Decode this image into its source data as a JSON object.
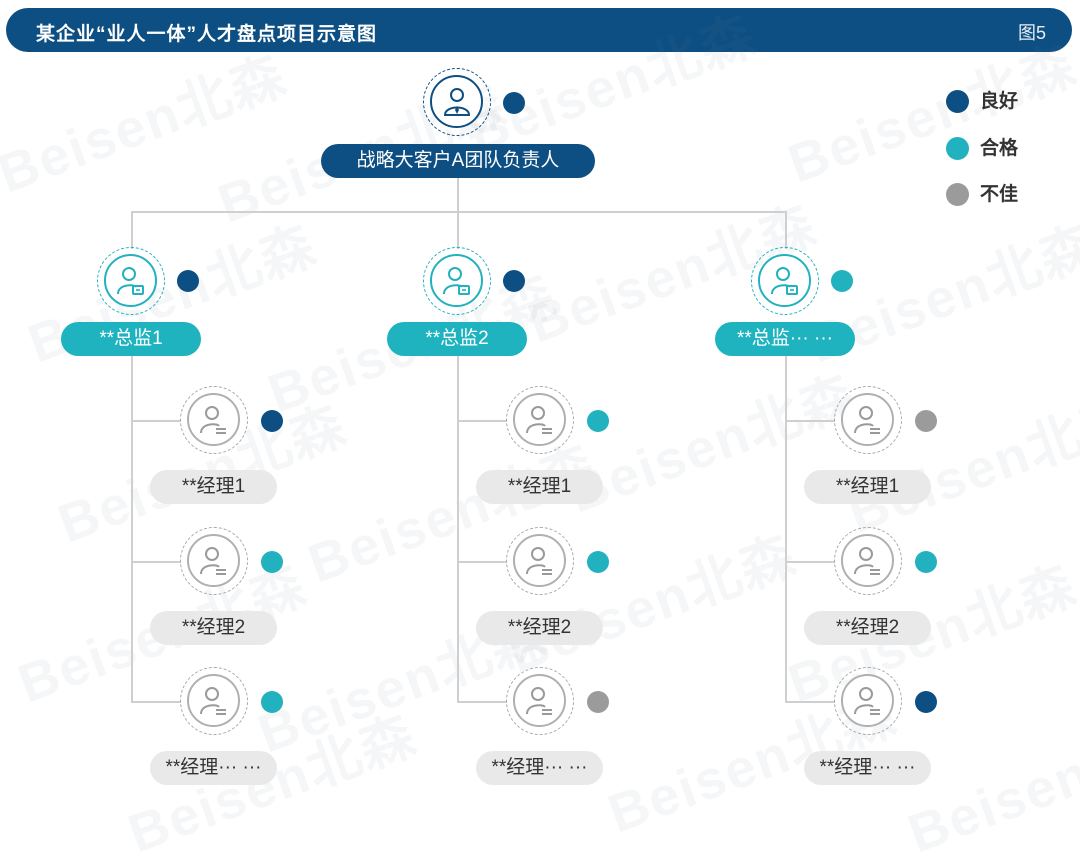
{
  "header": {
    "title": "某企业“业人一体”人才盘点项目示意图",
    "tag": "图5"
  },
  "colors": {
    "good": "#0d4f83",
    "qualified": "#22b1be",
    "poor": "#9b9b9b"
  },
  "legend": [
    {
      "label": "良好",
      "status": "good"
    },
    {
      "label": "合格",
      "status": "qualified"
    },
    {
      "label": "不佳",
      "status": "poor"
    }
  ],
  "root": {
    "label": "战略大客户A团队负责人",
    "status": "good",
    "icon": "leader-person-icon"
  },
  "directors": [
    {
      "label": "**总监1",
      "status": "good",
      "managers": [
        {
          "label": "**经理1",
          "status": "good"
        },
        {
          "label": "**经理2",
          "status": "qualified"
        },
        {
          "label": "**经理··· ···",
          "status": "qualified"
        }
      ]
    },
    {
      "label": "**总监2",
      "status": "good",
      "managers": [
        {
          "label": "**经理1",
          "status": "qualified"
        },
        {
          "label": "**经理2",
          "status": "qualified"
        },
        {
          "label": "**经理··· ···",
          "status": "poor"
        }
      ]
    },
    {
      "label": "**总监··· ···",
      "status": "qualified",
      "managers": [
        {
          "label": "**经理1",
          "status": "poor"
        },
        {
          "label": "**经理2",
          "status": "qualified"
        },
        {
          "label": "**经理··· ···",
          "status": "good"
        }
      ]
    }
  ],
  "watermark": "Beisen北森"
}
